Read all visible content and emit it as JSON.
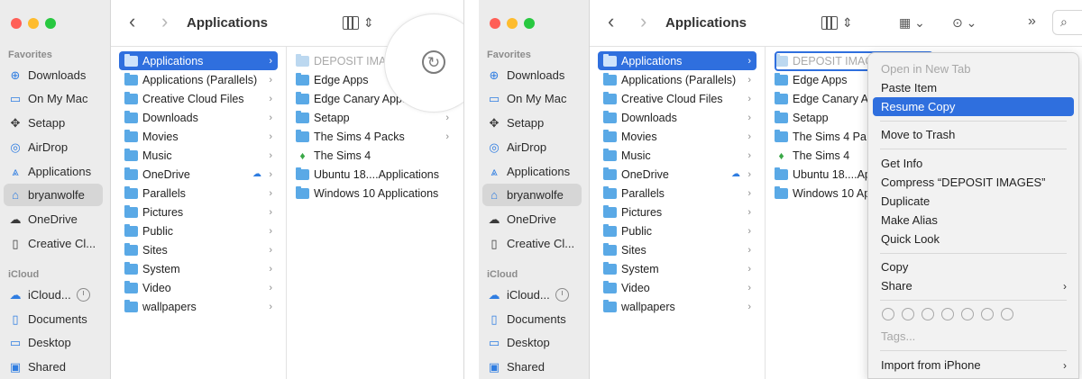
{
  "sidebar": {
    "favorites_label": "Favorites",
    "icloud_label": "iCloud",
    "items": [
      {
        "label": "Downloads",
        "icon": "download-icon"
      },
      {
        "label": "On My Mac",
        "icon": "folder-icon"
      },
      {
        "label": "Setapp",
        "icon": "setapp-icon"
      },
      {
        "label": "AirDrop",
        "icon": "airdrop-icon"
      },
      {
        "label": "Applications",
        "icon": "applications-icon"
      },
      {
        "label": "bryanwolfe",
        "icon": "home-icon"
      },
      {
        "label": "OneDrive",
        "icon": "cloud-icon"
      },
      {
        "label": "Creative Cl...",
        "icon": "document-icon"
      }
    ],
    "icloud_items": [
      {
        "label": "iCloud...",
        "icon": "cloud-icon"
      },
      {
        "label": "Documents",
        "icon": "document-icon"
      },
      {
        "label": "Desktop",
        "icon": "desktop-icon"
      },
      {
        "label": "Shared",
        "icon": "shared-folder-icon"
      }
    ]
  },
  "toolbar": {
    "title": "Applications",
    "back": "‹",
    "forward": "›"
  },
  "column1": [
    "Applications",
    "Applications (Parallels)",
    "Creative Cloud Files",
    "Downloads",
    "Movies",
    "Music",
    "OneDrive",
    "Parallels",
    "Pictures",
    "Public",
    "Sites",
    "System",
    "Video",
    "wallpapers"
  ],
  "column2_left": [
    "DEPOSIT IMA",
    "Edge Apps",
    "Edge Canary Apps",
    "Setapp",
    "The Sims 4 Packs",
    "The Sims 4",
    "Ubuntu 18....Applications",
    "Windows 10 Applications"
  ],
  "column2_right": [
    "DEPOSIT IMAG",
    "Edge Apps",
    "Edge Canary A",
    "Setapp",
    "The Sims 4 Pa",
    "The Sims 4",
    "Ubuntu 18....Ap",
    "Windows 10 Ap"
  ],
  "context_menu": {
    "items": [
      {
        "label": "Open in New Tab",
        "disabled": true
      },
      {
        "label": "Paste Item"
      },
      {
        "label": "Resume Copy",
        "highlighted": true
      },
      {
        "label": "Move to Trash"
      },
      {
        "label": "Get Info"
      },
      {
        "label": "Compress “DEPOSIT IMAGES”"
      },
      {
        "label": "Duplicate"
      },
      {
        "label": "Make Alias"
      },
      {
        "label": "Quick Look"
      },
      {
        "label": "Copy"
      },
      {
        "label": "Share",
        "submenu": true
      },
      {
        "label": "Tags...",
        "disabled": true
      },
      {
        "label": "Import from iPhone",
        "submenu": true
      }
    ]
  },
  "colors": {
    "accent": "#2f6fde",
    "folder": "#5aa9e6",
    "sidebar_bg": "#ececec"
  }
}
